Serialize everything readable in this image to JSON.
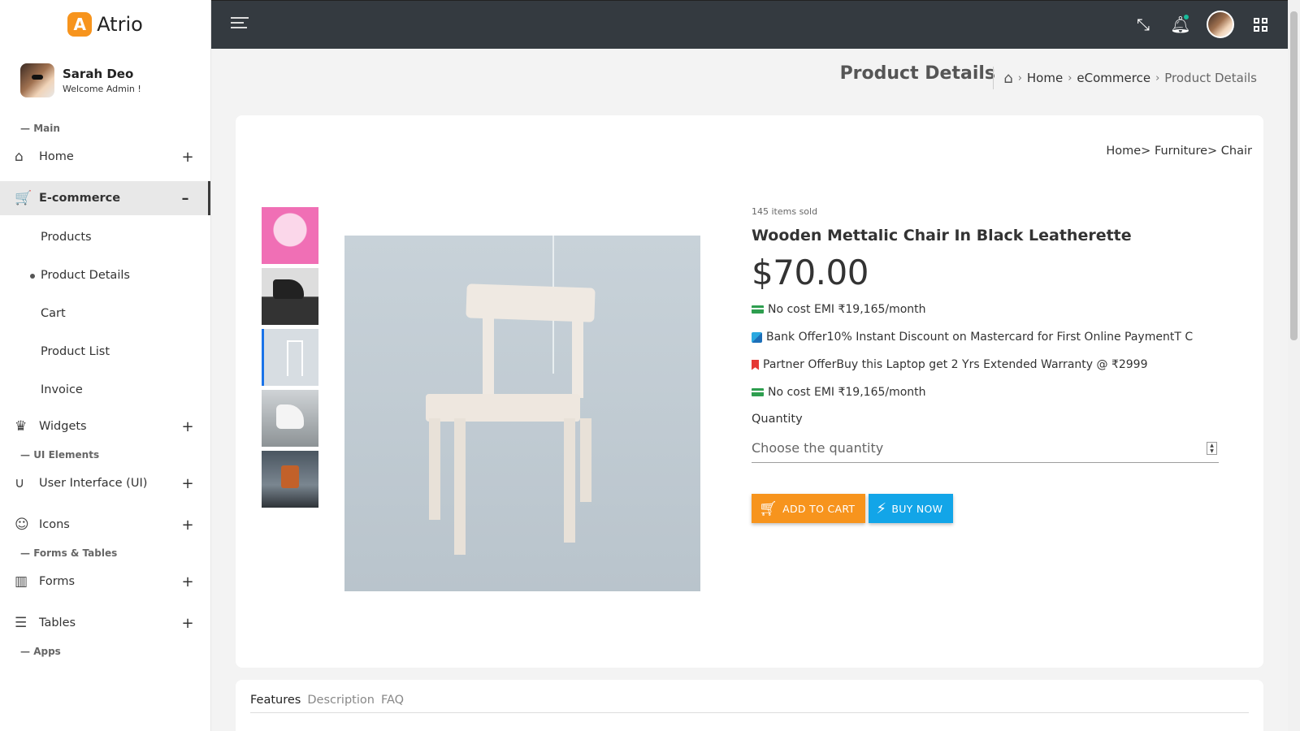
{
  "brand": {
    "logo_letter": "A",
    "name": "Atrio",
    "accent": "#f7941d"
  },
  "profile": {
    "name": "Sarah Deo",
    "role": "Welcome Admin !"
  },
  "sidebar": {
    "cap_main": "Main",
    "home": "Home",
    "ecommerce": "E-commerce",
    "sub": [
      "Products",
      "Product Details",
      "Cart",
      "Product List",
      "Invoice"
    ],
    "widgets": "Widgets",
    "cap_ui": "UI Elements",
    "ui": "User Interface (UI)",
    "icons": "Icons",
    "cap_forms": "Forms & Tables",
    "forms": "Forms",
    "tables": "Tables",
    "cap_apps": "Apps",
    "plus": "+",
    "minus": "–"
  },
  "page": {
    "title": "Product Details",
    "crumbs": [
      "Home",
      "eCommerce",
      "Product Details"
    ]
  },
  "product": {
    "path": "Home> Furniture> Chair",
    "sold": "145 items sold",
    "name": "Wooden Mettalic Chair In Black Leatherette",
    "price": "$70.00",
    "offers": [
      "No cost EMI ₹19,165/month",
      "Bank Offer10% Instant Discount on Mastercard for First Online PaymentT C",
      "Partner OfferBuy this Laptop   get 2 Yrs Extended Warranty @ ₹2999",
      "No cost EMI ₹19,165/month"
    ],
    "quantity_label": "Quantity",
    "quantity_placeholder": "Choose the quantity",
    "add_to_cart": "ADD TO CART",
    "buy_now": "BUY NOW"
  },
  "tabs": [
    "Features",
    "Description",
    "FAQ"
  ]
}
